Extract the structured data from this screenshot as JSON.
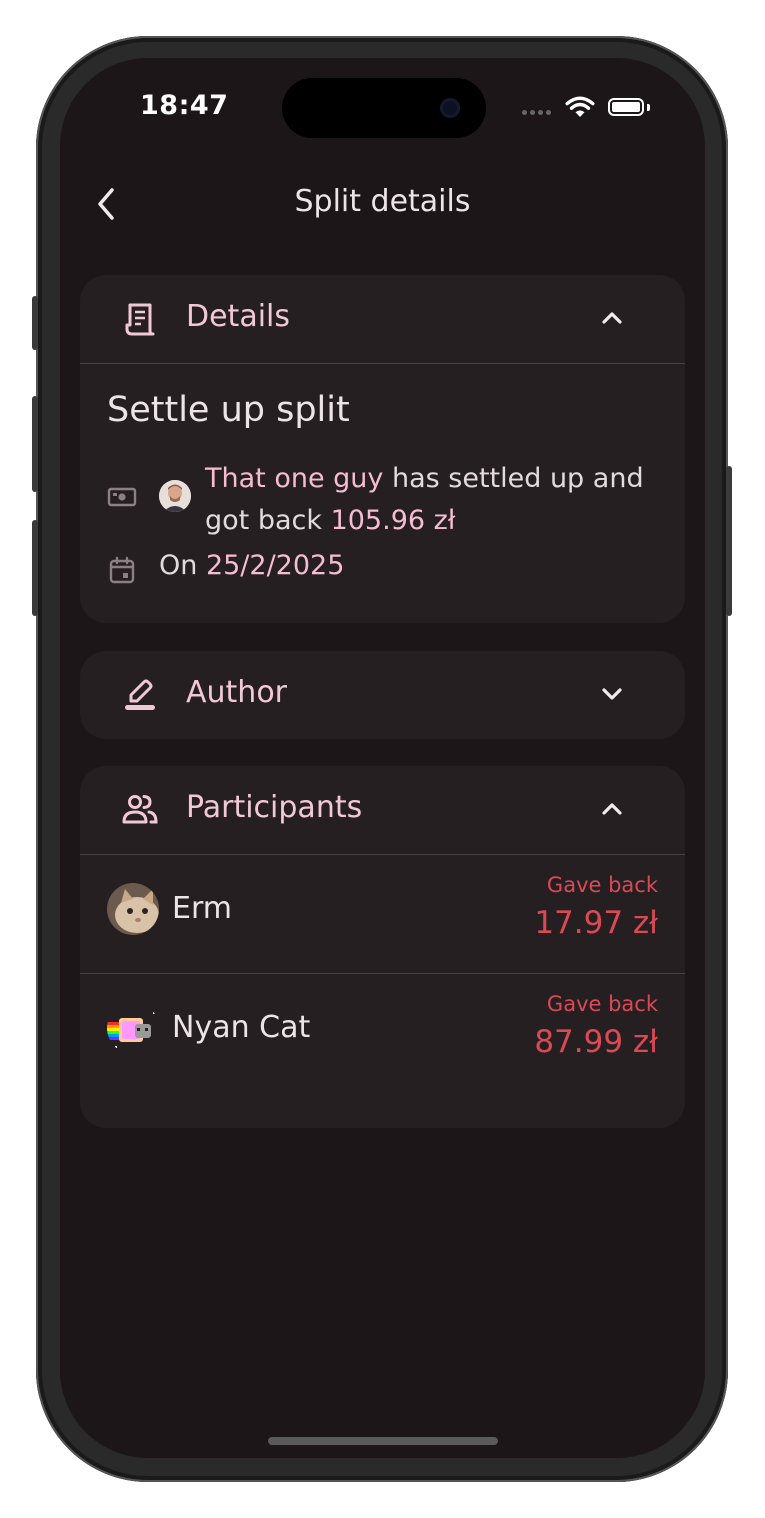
{
  "status_bar": {
    "time": "18:47"
  },
  "header": {
    "title": "Split details"
  },
  "details": {
    "section_title": "Details",
    "expense_title": "Settle up split",
    "payer_name": "That one guy",
    "settle_text": " has settled up and got back ",
    "amount": "105.96 zł",
    "date_prefix": "On ",
    "date": "25/2/2025"
  },
  "author": {
    "section_title": "Author"
  },
  "participants": {
    "section_title": "Participants",
    "items": [
      {
        "name": "Erm",
        "label": "Gave back",
        "amount": "17.97 zł"
      },
      {
        "name": "Nyan Cat",
        "label": "Gave back",
        "amount": "87.99 zł"
      }
    ]
  },
  "colors": {
    "background": "#1c1618",
    "card": "#261f22",
    "accent_pink": "#f5bcd2",
    "negative_red": "#d94a55"
  }
}
